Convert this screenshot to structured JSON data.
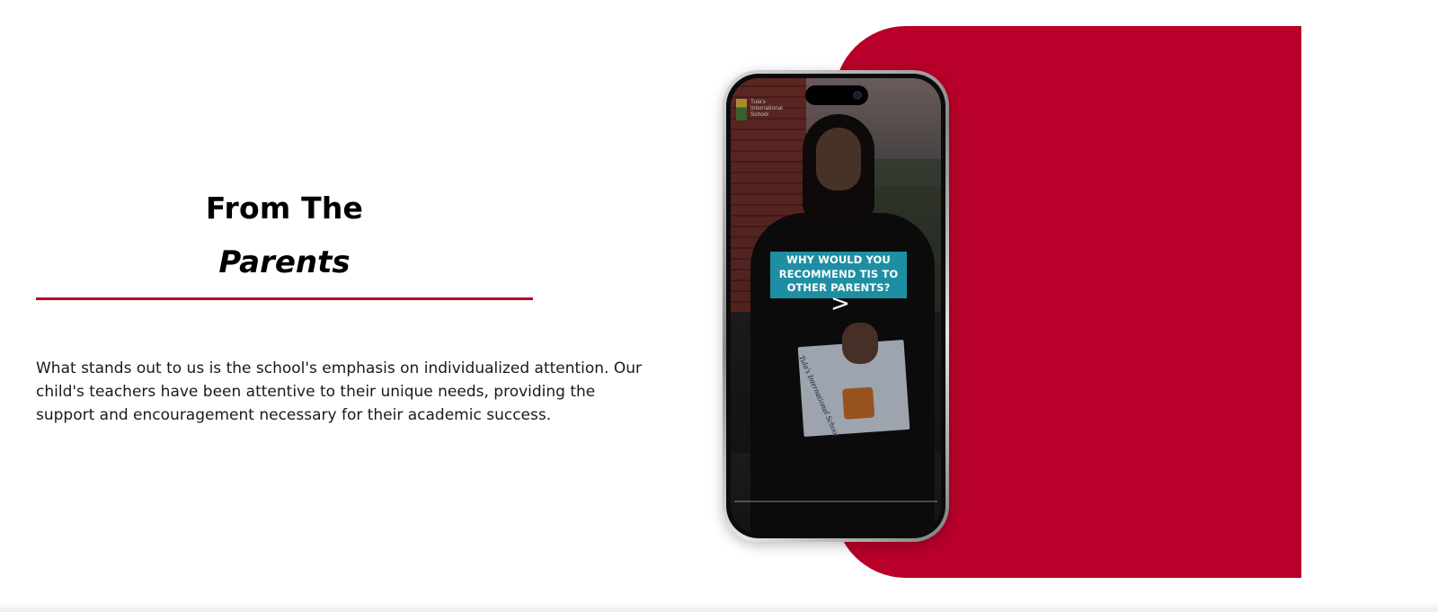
{
  "section": {
    "title_line1": "From The",
    "title_line2": "Parents",
    "testimonial": "What stands out to us is the school's emphasis on individualized attention. Our child's teachers have been attentive to their unique needs, providing the support and encouragement necessary for their academic success."
  },
  "video": {
    "logo_text": [
      "Tula's",
      "International",
      "School"
    ],
    "caption": "WHY WOULD YOU RECOMMEND TIS TO OTHER PARENTS?",
    "play_glyph": ">",
    "booklet_text": "Tula's International School"
  },
  "colors": {
    "accent": "#b8002a",
    "caption_bg": "#1e8fa3"
  },
  "icons": {
    "play": "play-icon",
    "camera": "camera-icon"
  }
}
